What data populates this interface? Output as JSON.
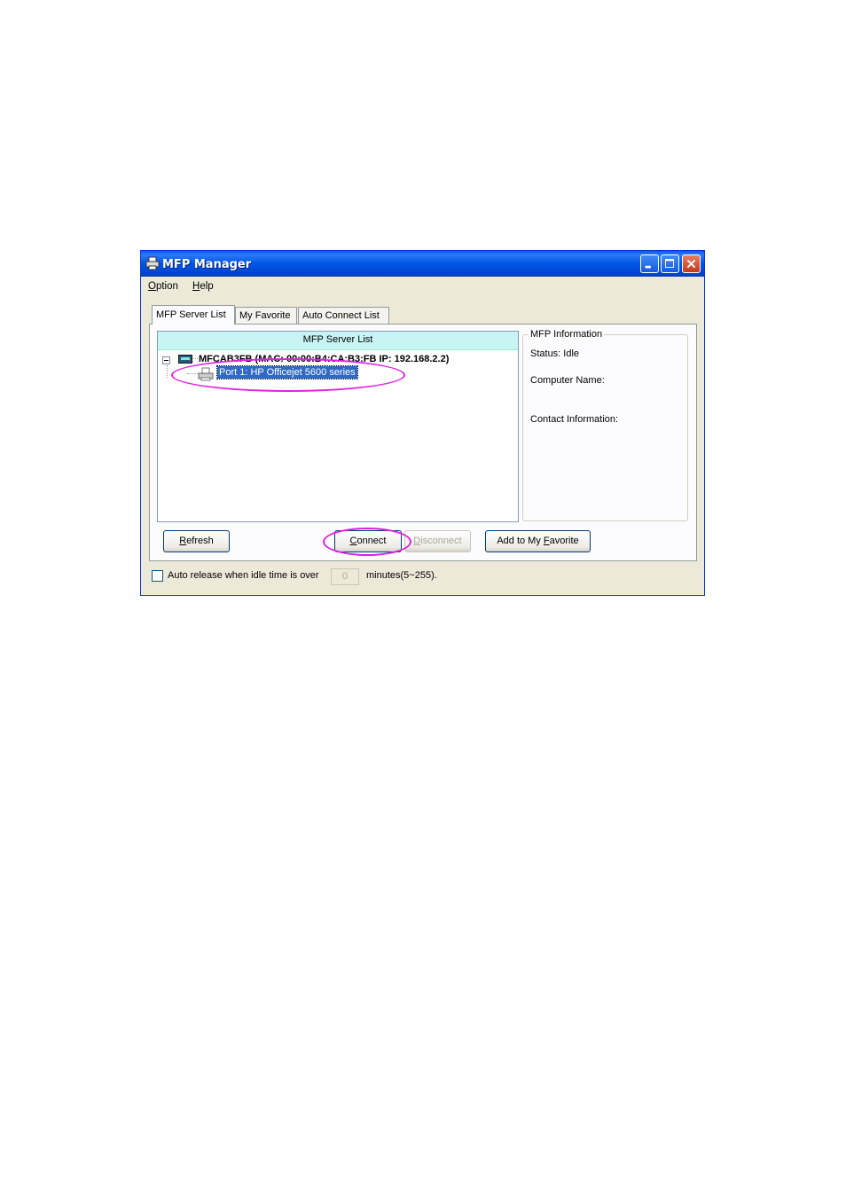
{
  "window": {
    "title": "MFP Manager"
  },
  "menu": [
    {
      "label": "Option",
      "key": "O",
      "rest": "ption"
    },
    {
      "label": "Help",
      "key": "H",
      "rest": "elp"
    }
  ],
  "tabs": [
    "MFP Server List",
    "My Favorite",
    "Auto Connect List"
  ],
  "server_list": {
    "header": "MFP Server List",
    "server": "MFCAB3FB (MAC: 00:00:B4:CA:B3:FB  IP: 192.168.2.2)",
    "port": "Port 1: HP Officejet 5600 series"
  },
  "info": {
    "legend": "MFP Information",
    "status": "Status: Idle",
    "computer_name": "Computer Name:",
    "contact": "Contact Information:"
  },
  "buttons": {
    "refresh": {
      "key": "R",
      "rest": "efresh"
    },
    "connect": {
      "key": "C",
      "rest": "onnect"
    },
    "disconnect": {
      "key": "D",
      "rest": "isconnect"
    },
    "favorite": {
      "prefix": "Add to My ",
      "key": "F",
      "rest": "avorite"
    }
  },
  "auto_release": {
    "label": "Auto release when idle time is over",
    "value": "0",
    "suffix": "minutes(5~255).",
    "checked": false
  },
  "colors": {
    "highlight_oval": "#e020e0",
    "selection": "#316ac5"
  }
}
